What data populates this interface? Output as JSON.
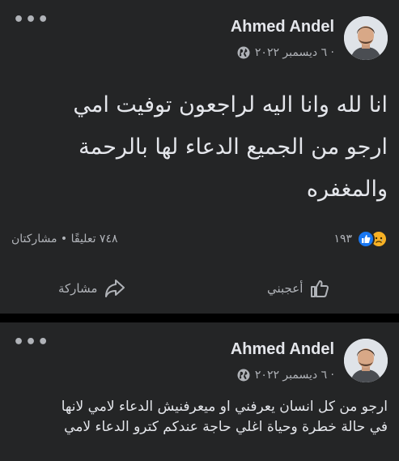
{
  "posts": [
    {
      "author": "Ahmed Andel",
      "date": "٦ ديسمبر ٢٠٢٢ ·",
      "text_lines": [
        "انا لله وانا اليه لراجعون توفيت امي",
        "ارجو من الجميع الدعاء لها بالرحمة",
        "والمغفره"
      ],
      "reaction_count": "١٩٣",
      "comments_shares": "٧٤٨ تعليقًا • مشاركتان",
      "like_label": "أعجبني",
      "share_label": "مشاركة"
    },
    {
      "author": "Ahmed Andel",
      "date": "٦ ديسمبر ٢٠٢٢ ·",
      "text_lines": [
        "ارجو من كل انسان يعرفني او ميعرفنيش الدعاء لامي لانها",
        "في حالة خطرة وحياة اغلي حاجة عندكم كترو الدعاء لامي"
      ]
    }
  ],
  "icons": {
    "more": "more-dots-icon",
    "globe": "globe-icon",
    "like": "thumbs-up-icon",
    "sad": "sad-reaction-icon",
    "share": "share-arrow-icon"
  },
  "colors": {
    "background": "#000000",
    "card": "#242526",
    "text": "#e4e6eb",
    "secondary_text": "#b0b3b8",
    "like_blue": "#1877f2",
    "sad_yellow": "#f7b125"
  }
}
